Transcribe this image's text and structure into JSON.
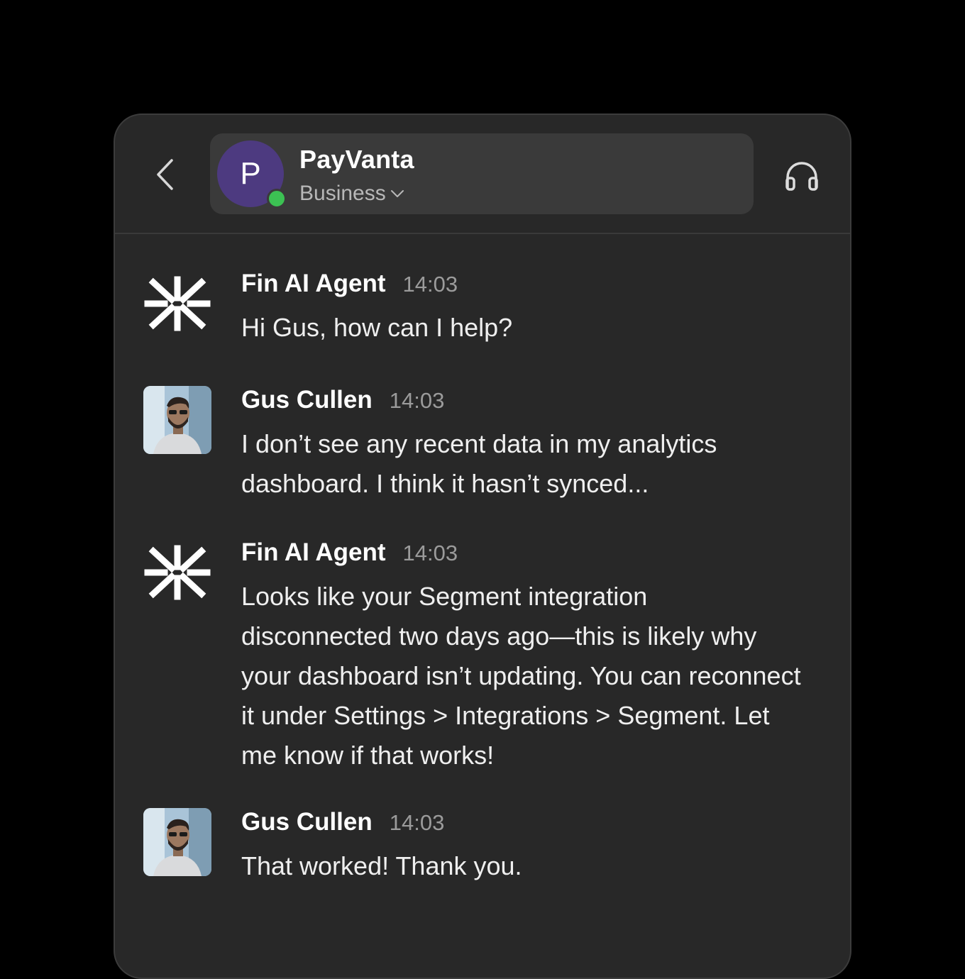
{
  "header": {
    "company_initial": "P",
    "company_name": "PayVanta",
    "plan": "Business",
    "avatar_color": "#4d3a80",
    "online_color": "#3cc153"
  },
  "icons": {
    "back": "chevron-left-icon",
    "plan_dropdown": "chevron-down-icon",
    "support": "headphones-icon",
    "agent_avatar": "fin-logo-icon"
  },
  "messages": [
    {
      "sender": "Fin AI Agent",
      "time": "14:03",
      "text": "Hi Gus, how can I help?"
    },
    {
      "sender": "Gus Cullen",
      "time": "14:03",
      "text": "I don’t see any recent data in my analytics dashboard. I think it hasn’t synced..."
    },
    {
      "sender": "Fin AI Agent",
      "time": "14:03",
      "text": "Looks like your Segment integration disconnected two days ago—this is likely why your dashboard isn’t updating. You can reconnect it under Settings > Integrations > Segment. Let me know if that works!"
    },
    {
      "sender": "Gus Cullen",
      "time": "14:03",
      "text": "That worked! Thank you."
    }
  ]
}
